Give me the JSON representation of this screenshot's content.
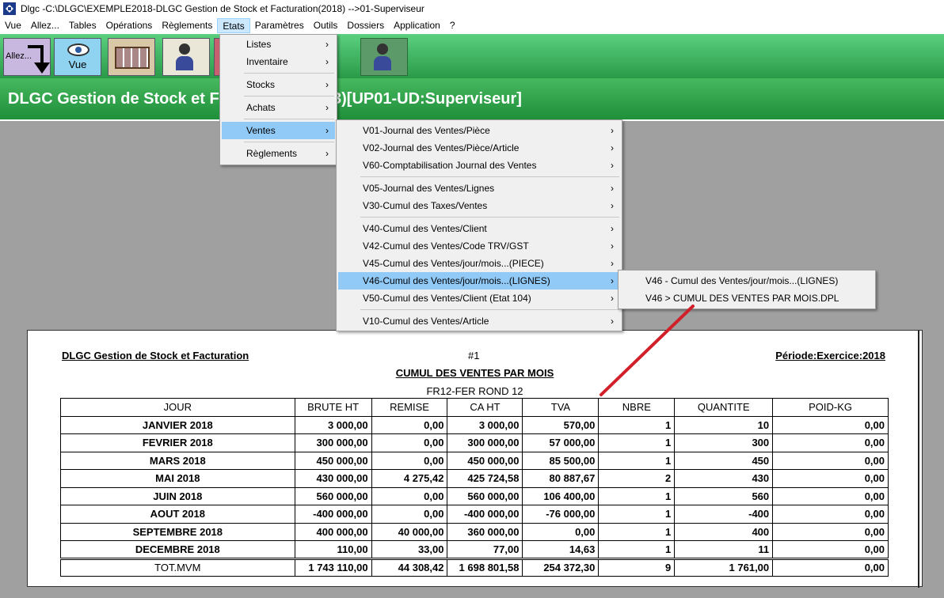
{
  "window": {
    "title": "Dlgc -C:\\DLGC\\EXEMPLE2018-DLGC Gestion de Stock et Facturation(2018) -->01-Superviseur"
  },
  "menubar": [
    "Vue",
    "Allez...",
    "Tables",
    "Opérations",
    "Règlements",
    "Etats",
    "Paramètres",
    "Outils",
    "Dossiers",
    "Application",
    "?"
  ],
  "toolbar": {
    "goto_label": "Allez...",
    "view_label": "Vue"
  },
  "banner": {
    "left": "DLGC Gestion de Stock et F",
    "right": "3)[UP01-UD:Superviseur]"
  },
  "etats_menu": {
    "listes": "Listes",
    "inventaire": "Inventaire",
    "stocks": "Stocks",
    "achats": "Achats",
    "ventes": "Ventes",
    "reglements": "Règlements"
  },
  "ventes_menu": {
    "v01": "V01-Journal des Ventes/Pièce",
    "v02": "V02-Journal des Ventes/Pièce/Article",
    "v60": "V60-Comptabilisation Journal des Ventes",
    "v05": "V05-Journal des Ventes/Lignes",
    "v30": "V30-Cumul des Taxes/Ventes",
    "v40": "V40-Cumul des Ventes/Client",
    "v42": "V42-Cumul des Ventes/Code TRV/GST",
    "v45": "V45-Cumul des Ventes/jour/mois...(PIECE)",
    "v46": "V46-Cumul des Ventes/jour/mois...(LIGNES)",
    "v50": "V50-Cumul des Ventes/Client (Etat 104)",
    "v10": "V10-Cumul des Ventes/Article"
  },
  "v46_menu": {
    "a": "V46 - Cumul des Ventes/jour/mois...(LIGNES)",
    "b": "V46 > CUMUL DES VENTES PAR MOIS.DPL"
  },
  "chevron": "›",
  "report": {
    "company": "DLGC Gestion de Stock et Facturation",
    "number": "#1",
    "period": "Période:Exercice:2018",
    "title": "CUMUL DES VENTES PAR MOIS",
    "subtitle": "FR12-FER ROND 12",
    "columns": [
      "JOUR",
      "BRUTE HT",
      "REMISE",
      "CA HT",
      "TVA",
      "NBRE",
      "QUANTITE",
      "POID-KG"
    ],
    "rows": [
      [
        "JANVIER 2018",
        "3 000,00",
        "0,00",
        "3 000,00",
        "570,00",
        "1",
        "10",
        "0,00"
      ],
      [
        "FEVRIER 2018",
        "300 000,00",
        "0,00",
        "300 000,00",
        "57 000,00",
        "1",
        "300",
        "0,00"
      ],
      [
        "MARS 2018",
        "450 000,00",
        "0,00",
        "450 000,00",
        "85 500,00",
        "1",
        "450",
        "0,00"
      ],
      [
        "MAI 2018",
        "430 000,00",
        "4 275,42",
        "425 724,58",
        "80 887,67",
        "2",
        "430",
        "0,00"
      ],
      [
        "JUIN 2018",
        "560 000,00",
        "0,00",
        "560 000,00",
        "106 400,00",
        "1",
        "560",
        "0,00"
      ],
      [
        "AOUT 2018",
        "-400 000,00",
        "0,00",
        "-400 000,00",
        "-76 000,00",
        "1",
        "-400",
        "0,00"
      ],
      [
        "SEPTEMBRE 2018",
        "400 000,00",
        "40 000,00",
        "360 000,00",
        "0,00",
        "1",
        "400",
        "0,00"
      ],
      [
        "DECEMBRE 2018",
        "110,00",
        "33,00",
        "77,00",
        "14,63",
        "1",
        "11",
        "0,00"
      ]
    ],
    "total": [
      "TOT.MVM",
      "1 743 110,00",
      "44 308,42",
      "1 698 801,58",
      "254 372,30",
      "9",
      "1 761,00",
      "0,00"
    ]
  },
  "colors": {
    "toolbar_green": "#2a9a48",
    "highlight": "#91c9f7",
    "annotation": "#d0202a"
  }
}
